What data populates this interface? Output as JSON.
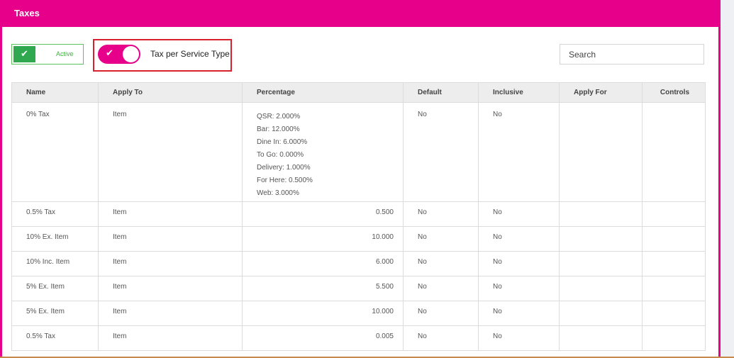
{
  "header": {
    "title": "Taxes"
  },
  "active_toggle": {
    "label": "Active"
  },
  "service_type_toggle": {
    "label": "Tax per Service Type"
  },
  "search": {
    "placeholder": "Search"
  },
  "table": {
    "columns": [
      "Name",
      "Apply To",
      "Percentage",
      "Default",
      "Inclusive",
      "Apply For",
      "Controls"
    ],
    "rows": [
      {
        "name": "0% Tax",
        "apply_to": "Item",
        "percentage_lines": [
          "QSR: 2.000%",
          "Bar: 12.000%",
          "Dine In: 6.000%",
          "To Go: 0.000%",
          "Delivery: 1.000%",
          "For Here: 0.500%",
          "Web: 3.000%"
        ],
        "default": "No",
        "inclusive": "No",
        "apply_for": ""
      },
      {
        "name": "0.5% Tax",
        "apply_to": "Item",
        "percentage": "0.500",
        "default": "No",
        "inclusive": "No",
        "apply_for": ""
      },
      {
        "name": "10% Ex. Item",
        "apply_to": "Item",
        "percentage": "10.000",
        "default": "No",
        "inclusive": "No",
        "apply_for": ""
      },
      {
        "name": "10% Inc. Item",
        "apply_to": "Item",
        "percentage": "6.000",
        "default": "No",
        "inclusive": "No",
        "apply_for": ""
      },
      {
        "name": "5% Ex. Item",
        "apply_to": "Item",
        "percentage": "5.500",
        "default": "No",
        "inclusive": "No",
        "apply_for": ""
      },
      {
        "name": "5% Ex. Item",
        "apply_to": "Item",
        "percentage": "10.000",
        "default": "No",
        "inclusive": "No",
        "apply_for": ""
      },
      {
        "name": "0.5% Tax",
        "apply_to": "Item",
        "percentage": "0.005",
        "default": "No",
        "inclusive": "No",
        "apply_for": ""
      }
    ]
  },
  "colors": {
    "brand": "#e6008a",
    "active_green": "#2fa84f",
    "highlight": "#d8212f"
  },
  "icons": {
    "active_check": "check-icon",
    "service_switch_check": "check-icon"
  }
}
